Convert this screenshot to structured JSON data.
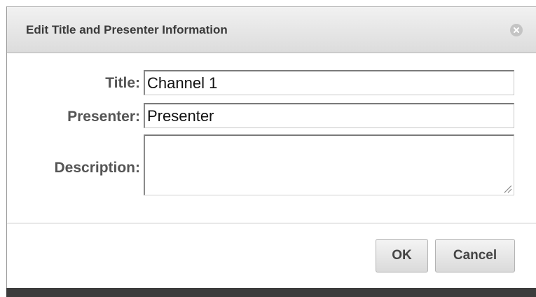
{
  "dialog": {
    "title": "Edit Title and Presenter Information",
    "close_icon": "close-circle-icon"
  },
  "form": {
    "title_label": "Title:",
    "title_value": "Channel 1",
    "presenter_label": "Presenter:",
    "presenter_value": "Presenter",
    "description_label": "Description:",
    "description_value": ""
  },
  "footer": {
    "ok_label": "OK",
    "cancel_label": "Cancel"
  },
  "colors": {
    "header_gradient_top": "#f1f1f1",
    "header_gradient_bottom": "#dcdcdc",
    "label_text": "#555555",
    "bottom_bar": "#3c3c3c"
  }
}
